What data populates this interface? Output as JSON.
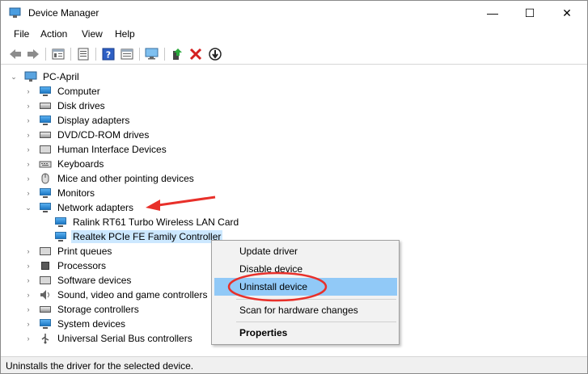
{
  "window": {
    "title": "Device Manager",
    "controls": {
      "minimize": "—",
      "maximize": "☐",
      "close": "✕"
    }
  },
  "menu": [
    "File",
    "Action",
    "View",
    "Help"
  ],
  "toolbar": {
    "icons": [
      "back-icon",
      "forward-icon",
      "properties-view-icon",
      "list-view-icon",
      "help-icon",
      "resources-view-icon",
      "scan-hardware-icon",
      "update-driver-icon",
      "uninstall-icon",
      "disable-icon"
    ]
  },
  "tree": {
    "root": "PC-April",
    "categories": [
      "Computer",
      "Disk drives",
      "Display adapters",
      "DVD/CD-ROM drives",
      "Human Interface Devices",
      "Keyboards",
      "Mice and other pointing devices",
      "Monitors",
      "Network adapters",
      "Print queues",
      "Processors",
      "Software devices",
      "Sound, video and game controllers",
      "Storage controllers",
      "System devices",
      "Universal Serial Bus controllers"
    ],
    "network_children": [
      "Ralink RT61 Turbo Wireless LAN Card",
      "Realtek PCIe FE Family Controller"
    ]
  },
  "context_menu": {
    "items": [
      "Update driver",
      "Disable device",
      "Uninstall device",
      "Scan for hardware changes",
      "Properties"
    ],
    "highlight_color": "#91c9f7"
  },
  "status": "Uninstalls the driver for the selected device.",
  "annotation_color": "#e8302a"
}
